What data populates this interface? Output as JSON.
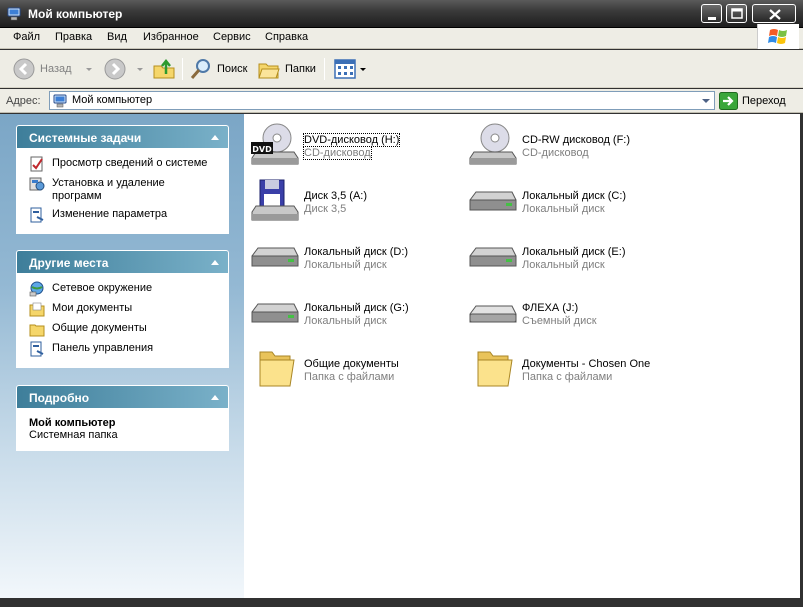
{
  "window": {
    "title": "Мой компьютер",
    "icon": "my-computer-icon"
  },
  "menu": [
    "Файл",
    "Правка",
    "Вид",
    "Избранное",
    "Сервис",
    "Справка"
  ],
  "toolbar": {
    "back_label": "Назад",
    "search_label": "Поиск",
    "folders_label": "Папки"
  },
  "address": {
    "label": "Адрес:",
    "value": "Мой компьютер",
    "go_label": "Переход"
  },
  "panels": {
    "system_tasks": {
      "title": "Системные задачи",
      "items": [
        {
          "label": "Просмотр сведений о системе",
          "icon": "system-info-icon"
        },
        {
          "label": "Установка и удаление программ",
          "icon": "add-remove-programs-icon"
        },
        {
          "label": "Изменение параметра",
          "icon": "control-panel-icon"
        }
      ]
    },
    "other_places": {
      "title": "Другие места",
      "items": [
        {
          "label": "Сетевое окружение",
          "icon": "network-places-icon"
        },
        {
          "label": "Мои документы",
          "icon": "my-documents-icon"
        },
        {
          "label": "Общие документы",
          "icon": "shared-folder-icon"
        },
        {
          "label": "Панель управления",
          "icon": "control-panel-icon"
        }
      ]
    },
    "details": {
      "title": "Подробно",
      "name": "Мой компьютер",
      "description": "Системная папка"
    }
  },
  "items": [
    {
      "name": "DVD-дисковод (H:)",
      "type": "CD-дисковод",
      "icon": "dvd-drive-icon"
    },
    {
      "name": "CD-RW дисковод (F:)",
      "type": "CD-дисковод",
      "icon": "cd-drive-icon"
    },
    {
      "name": "Диск 3,5 (A:)",
      "type": "Диск 3,5",
      "icon": "floppy-drive-icon"
    },
    {
      "name": "Локальный диск (C:)",
      "type": "Локальный диск",
      "icon": "hard-disk-icon"
    },
    {
      "name": "Локальный диск (D:)",
      "type": "Локальный диск",
      "icon": "hard-disk-icon"
    },
    {
      "name": "Локальный диск (E:)",
      "type": "Локальный диск",
      "icon": "hard-disk-icon"
    },
    {
      "name": "Локальный диск (G:)",
      "type": "Локальный диск",
      "icon": "hard-disk-icon"
    },
    {
      "name": "ФЛЕХА (J:)",
      "type": "Съемный диск",
      "icon": "removable-disk-icon"
    },
    {
      "name": "Общие документы",
      "type": "Папка с файлами",
      "icon": "folder-icon"
    },
    {
      "name": "Документы - Chosen One",
      "type": "Папка с файлами",
      "icon": "folder-icon"
    }
  ]
}
